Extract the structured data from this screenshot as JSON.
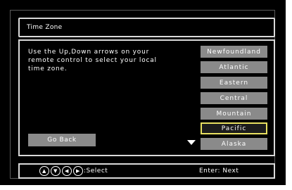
{
  "title": "Time Zone",
  "instructions": "Use the Up,Down arrows on your\nremote control to select your local\ntime zone.",
  "go_back_label": "Go Back",
  "timezones": [
    "Newfoundland",
    "Atlantic",
    "Eastern",
    "Central",
    "Mountain",
    "Pacific",
    "Alaska"
  ],
  "selected_timezone": "Pacific",
  "footer": {
    "select_label": ":Select",
    "enter_label": "Enter: Next",
    "nav_icons": [
      "arrow-up-icon",
      "arrow-down-icon",
      "arrow-left-icon",
      "arrow-right-icon"
    ]
  },
  "colors": {
    "background": "#000000",
    "button": "#8a8a8a",
    "highlight_border": "#e8e060"
  }
}
